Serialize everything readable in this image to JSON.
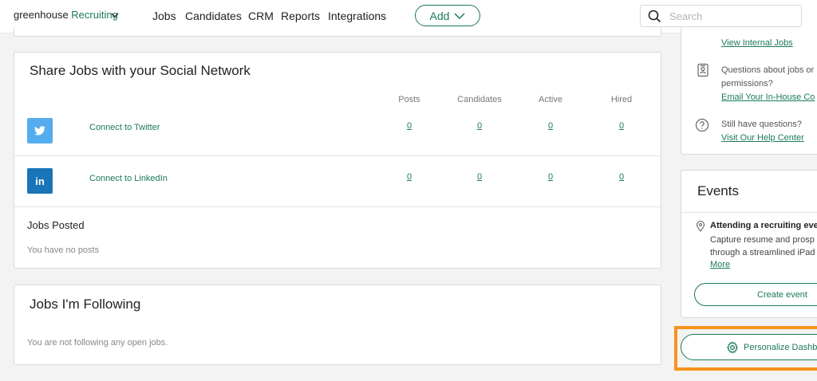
{
  "nav": {
    "logo_part1": "greenhouse",
    "logo_part2": "Recruiting",
    "links": [
      "Jobs",
      "Candidates",
      "CRM",
      "Reports",
      "Integrations"
    ],
    "add_label": "Add",
    "search_placeholder": "Search"
  },
  "share": {
    "title": "Share Jobs with your Social Network",
    "columns": [
      "Posts",
      "Candidates",
      "Active",
      "Hired"
    ],
    "rows": [
      {
        "network": "twitter",
        "label": "Connect to Twitter",
        "stats": [
          "0",
          "0",
          "0",
          "0"
        ]
      },
      {
        "network": "linkedin",
        "label": "Connect to LinkedIn",
        "stats": [
          "0",
          "0",
          "0",
          "0"
        ]
      }
    ],
    "linkedin_glyph": "in",
    "jobs_posted_title": "Jobs Posted",
    "jobs_posted_empty": "You have no posts"
  },
  "following": {
    "title": "Jobs I'm Following",
    "empty": "You are not following any open jobs."
  },
  "help": {
    "view_internal_jobs": "View Internal Jobs",
    "questions_line1": "Questions about jobs or",
    "questions_line2": "permissions?",
    "email_link": "Email Your In-House Co",
    "still_questions": "Still have questions?",
    "help_center_link": "Visit Our Help Center"
  },
  "events": {
    "title": "Events",
    "item_title": "Attending a recruiting eve",
    "item_desc_line1": "Capture resume and prosp",
    "item_desc_line2": "through a streamlined iPad",
    "more_link": "More",
    "create_label": "Create event"
  },
  "personalize": {
    "label": "Personalize Dashb"
  },
  "colors": {
    "accent": "#1b7a5a",
    "twitter": "#55acee",
    "linkedin": "#1a75b8",
    "highlight": "#f7931e"
  }
}
